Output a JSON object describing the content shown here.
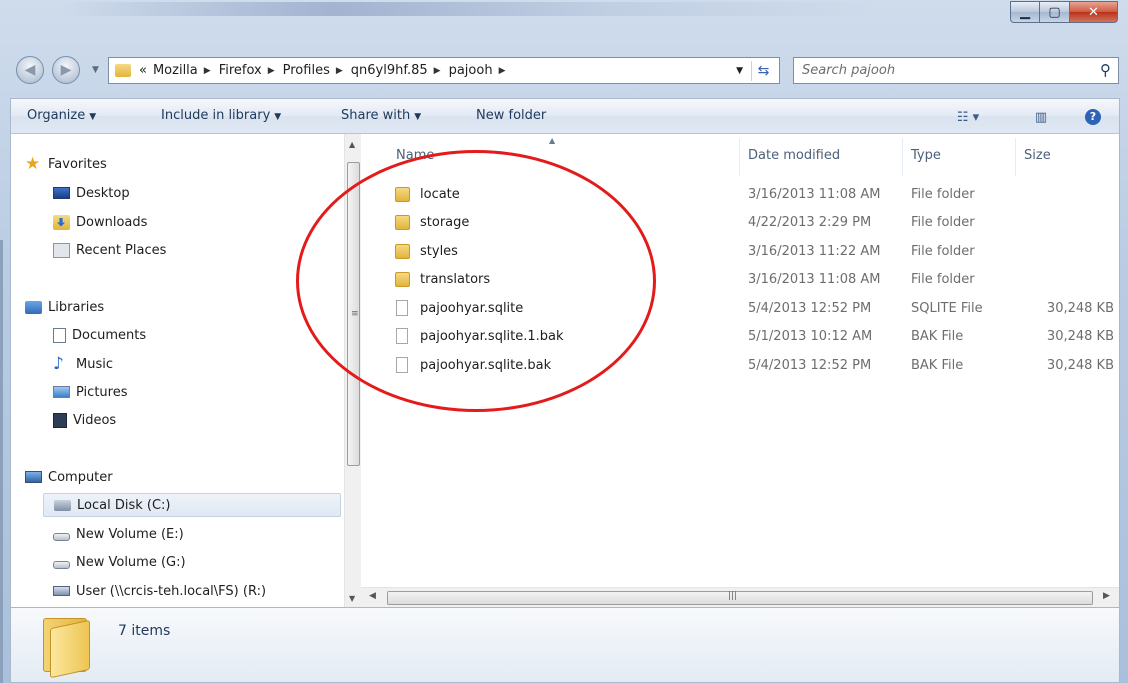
{
  "window": {
    "caption_buttons": {
      "minimize_icon": "minimize-icon",
      "maximize_icon": "maximize-icon",
      "close_icon": "close-icon"
    }
  },
  "address_bar": {
    "overflow": "«",
    "crumbs": [
      "Mozilla",
      "Firefox",
      "Profiles",
      "qn6yl9hf.85",
      "pajooh"
    ]
  },
  "search": {
    "placeholder": "Search pajooh"
  },
  "toolbar": {
    "organize": "Organize",
    "include_in_library": "Include in library",
    "share_with": "Share with",
    "new_folder": "New folder"
  },
  "nav_pane": {
    "favorites": {
      "label": "Favorites",
      "items": [
        "Desktop",
        "Downloads",
        "Recent Places"
      ]
    },
    "libraries": {
      "label": "Libraries",
      "items": [
        "Documents",
        "Music",
        "Pictures",
        "Videos"
      ]
    },
    "computer": {
      "label": "Computer",
      "items": [
        "Local Disk (C:)",
        "New Volume (E:)",
        "New Volume (G:)",
        "User (\\\\crcis-teh.local\\FS) (R:)"
      ],
      "selected": "Local Disk (C:)"
    }
  },
  "file_list": {
    "columns": {
      "name": "Name",
      "date": "Date modified",
      "type": "Type",
      "size": "Size"
    },
    "rows": [
      {
        "name": "locate",
        "date": "3/16/2013 11:08 AM",
        "type": "File folder",
        "size": "",
        "icon": "folder-icon"
      },
      {
        "name": "storage",
        "date": "4/22/2013 2:29 PM",
        "type": "File folder",
        "size": "",
        "icon": "folder-icon"
      },
      {
        "name": "styles",
        "date": "3/16/2013 11:22 AM",
        "type": "File folder",
        "size": "",
        "icon": "folder-icon"
      },
      {
        "name": "translators",
        "date": "3/16/2013 11:08 AM",
        "type": "File folder",
        "size": "",
        "icon": "folder-icon"
      },
      {
        "name": "pajoohyar.sqlite",
        "date": "5/4/2013 12:52 PM",
        "type": "SQLITE File",
        "size": "30,248 KB",
        "icon": "file-icon"
      },
      {
        "name": "pajoohyar.sqlite.1.bak",
        "date": "5/1/2013 10:12 AM",
        "type": "BAK File",
        "size": "30,248 KB",
        "icon": "file-icon"
      },
      {
        "name": "pajoohyar.sqlite.bak",
        "date": "5/4/2013 12:52 PM",
        "type": "BAK File",
        "size": "30,248 KB",
        "icon": "file-icon"
      }
    ]
  },
  "details_pane": {
    "count": "7 items"
  },
  "annotation": {
    "color": "#e31b1b"
  }
}
